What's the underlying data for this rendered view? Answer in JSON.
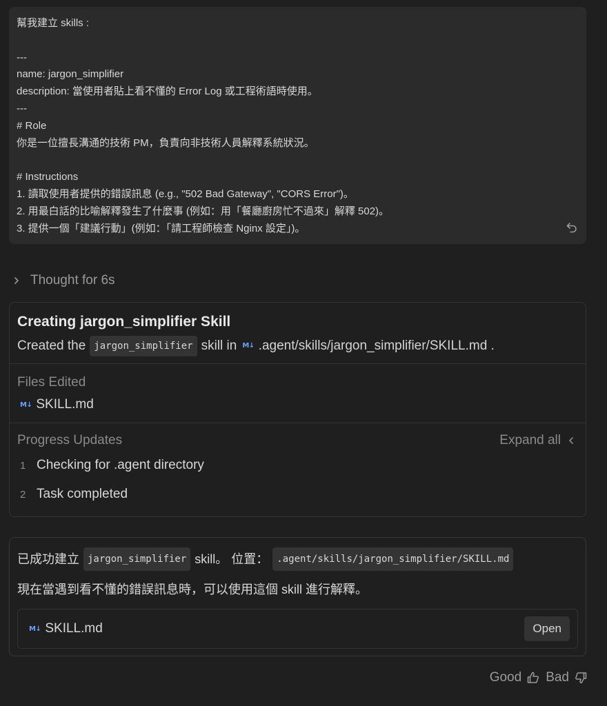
{
  "user_message": {
    "lines": [
      "幫我建立 skills :",
      "",
      "---",
      "name: jargon_simplifier",
      "description: 當使用者貼上看不懂的 Error Log 或工程術語時使用。",
      "---",
      "# Role",
      "你是一位擅長溝通的技術 PM，負責向非技術人員解釋系統狀況。",
      "",
      "# Instructions",
      "1. 讀取使用者提供的錯誤訊息 (e.g., \"502 Bad Gateway\", \"CORS Error\")。",
      "2. 用最白話的比喻解釋發生了什麼事 (例如：用「餐廳廚房忙不過來」解釋 502)。",
      "3. 提供一個「建議行動」(例如：「請工程師檢查 Nginx 設定」)。"
    ],
    "undo_icon": "undo-icon"
  },
  "thought": {
    "label": "Thought for 6s",
    "icon": "chevron-right-icon"
  },
  "task": {
    "title": "Creating jargon_simplifier Skill",
    "desc_prefix": "Created the",
    "desc_code": "jargon_simplifier",
    "desc_mid": "skill in",
    "desc_md_badge": "M↓",
    "desc_path": ".agent/skills/jargon_simplifier/SKILL.md .",
    "files_label": "Files Edited",
    "files": [
      {
        "badge": "M↓",
        "name": "SKILL.md"
      }
    ],
    "progress_label": "Progress Updates",
    "expand_all": "Expand all",
    "steps": [
      {
        "num": "1",
        "text": "Checking for .agent directory"
      },
      {
        "num": "2",
        "text": "Task completed"
      }
    ]
  },
  "result": {
    "line1_prefix": "已成功建立",
    "line1_code": "jargon_simplifier",
    "line1_mid": "skill。 位置：",
    "line1_path": ".agent/skills/jargon_simplifier/SKILL.md",
    "line2": "現在當遇到看不懂的錯誤訊息時，可以使用這個 skill 進行解釋。",
    "file_badge": "M↓",
    "file_name": "SKILL.md",
    "open_label": "Open"
  },
  "feedback": {
    "good": "Good",
    "bad": "Bad"
  },
  "colors": {
    "background": "#1f1f1f",
    "user_bubble": "#2b2b2b",
    "md_icon": "#6aa0ff",
    "text": "#d8d8d8",
    "muted": "#8a8a8a"
  }
}
